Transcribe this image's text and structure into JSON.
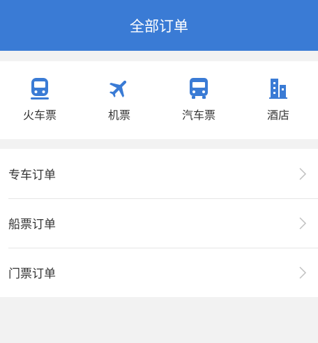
{
  "header": {
    "title": "全部订单"
  },
  "categories": [
    {
      "label": "火车票",
      "icon": "train-icon"
    },
    {
      "label": "机票",
      "icon": "airplane-icon"
    },
    {
      "label": "汽车票",
      "icon": "bus-icon"
    },
    {
      "label": "酒店",
      "icon": "hotel-icon"
    }
  ],
  "orders": [
    {
      "label": "专车订单"
    },
    {
      "label": "船票订单"
    },
    {
      "label": "门票订单"
    }
  ],
  "colors": {
    "accent": "#3a7bd5",
    "background": "#f2f2f2",
    "text": "#333333",
    "chevron": "#c0c0c0"
  }
}
